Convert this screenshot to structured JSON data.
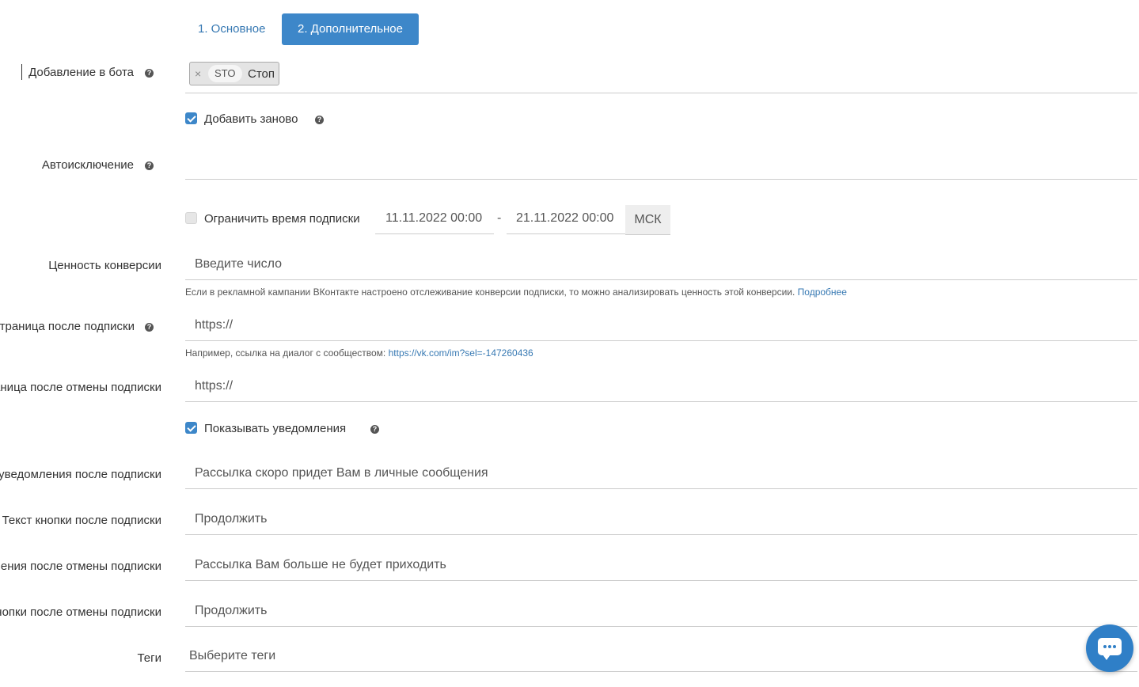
{
  "tabs": [
    {
      "label": "1. Основное",
      "active": false
    },
    {
      "label": "2. Дополнительное",
      "active": true
    }
  ],
  "fields": {
    "bot_add": {
      "label": "Добавление в бота",
      "tag_remove": "×",
      "tag_code": "STO",
      "tag_name": "Стоп"
    },
    "re_add": {
      "label": "Добавить заново",
      "checked": true
    },
    "auto_exclude": {
      "label": "Автоисключение",
      "value": ""
    },
    "limit_time": {
      "label": "Ограничить время подписки",
      "checked": false,
      "from": "11.11.2022 00:00",
      "separator": "-",
      "to": "21.11.2022 00:00",
      "timezone": "МСК"
    },
    "conversion_value": {
      "label": "Ценность конверсии",
      "placeholder": "Введите число",
      "hint": "Если в рекламной кампании ВКонтакте настроено отслеживание конверсии подписки, то можно анализировать ценность этой конверсии.",
      "hint_link": "Подробнее"
    },
    "page_after_sub": {
      "label": "Страница после подписки",
      "placeholder": "https://",
      "hint": "Например, ссылка на диалог с сообществом:",
      "hint_link": "https://vk.com/im?sel=-147260436"
    },
    "page_after_unsub": {
      "label": "Страница после отмены подписки",
      "placeholder": "https://"
    },
    "show_notifications": {
      "label": "Показывать уведомления",
      "checked": true
    },
    "notif_after_sub": {
      "label": "Текст уведомления после подписки",
      "value": "Рассылка скоро придет Вам в личные сообщения"
    },
    "btn_after_sub": {
      "label": "Текст кнопки после подписки",
      "value": "Продолжить"
    },
    "notif_after_unsub": {
      "label": "Текст уведомления после отмены подписки",
      "value": "Рассылка Вам больше не будет приходить"
    },
    "btn_after_unsub": {
      "label": "Текст кнопки после отмены подписки",
      "value": "Продолжить"
    },
    "tags": {
      "label": "Теги",
      "placeholder": "Выберите теги"
    }
  },
  "colors": {
    "accent": "#3d87c9",
    "link": "#3779b3"
  },
  "icons": {
    "help": "question-circle-icon",
    "chat": "chat-bubble-icon"
  }
}
